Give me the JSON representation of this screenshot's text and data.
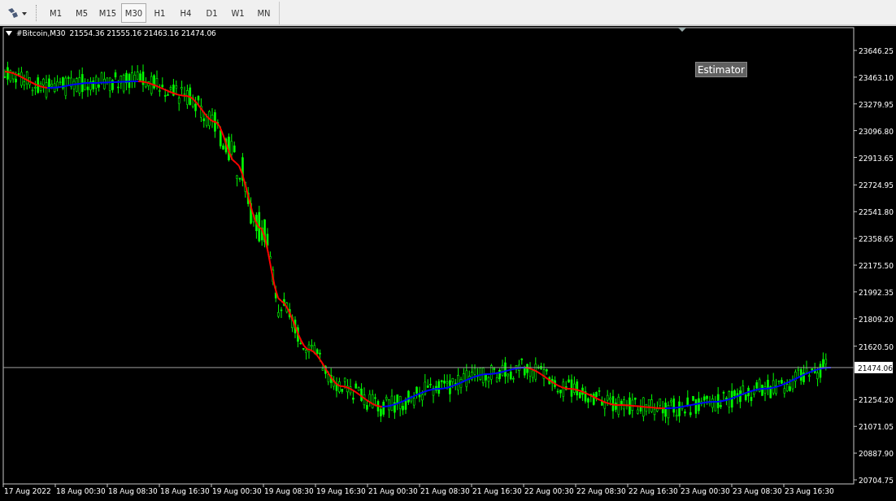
{
  "toolbar": {
    "timeframes": [
      {
        "label": "M1",
        "selected": false
      },
      {
        "label": "M5",
        "selected": false
      },
      {
        "label": "M15",
        "selected": false
      },
      {
        "label": "M30",
        "selected": true
      },
      {
        "label": "H1",
        "selected": false
      },
      {
        "label": "H4",
        "selected": false
      },
      {
        "label": "D1",
        "selected": false
      },
      {
        "label": "W1",
        "selected": false
      },
      {
        "label": "MN",
        "selected": false
      }
    ]
  },
  "chart": {
    "symbol": "#Bitcoin,M30",
    "ohlc": "21554.36 21555.16 21463.16 21474.06",
    "button": "Estimator",
    "price_labels": [
      "23646.25",
      "23463.10",
      "23279.95",
      "23096.80",
      "22913.65",
      "22724.95",
      "22541.80",
      "22358.65",
      "22175.50",
      "21992.35",
      "21809.20",
      "21620.50",
      "21254.20",
      "21071.05",
      "20887.90",
      "20704.75"
    ],
    "current_price": "21474.06",
    "time_labels": [
      "17 Aug 2022",
      "18 Aug 00:30",
      "18 Aug 08:30",
      "18 Aug 16:30",
      "19 Aug 00:30",
      "19 Aug 08:30",
      "19 Aug 16:30",
      "21 Aug 00:30",
      "21 Aug 08:30",
      "21 Aug 16:30",
      "22 Aug 00:30",
      "22 Aug 08:30",
      "22 Aug 16:30",
      "23 Aug 00:30",
      "23 Aug 08:30",
      "23 Aug 16:30"
    ]
  }
}
